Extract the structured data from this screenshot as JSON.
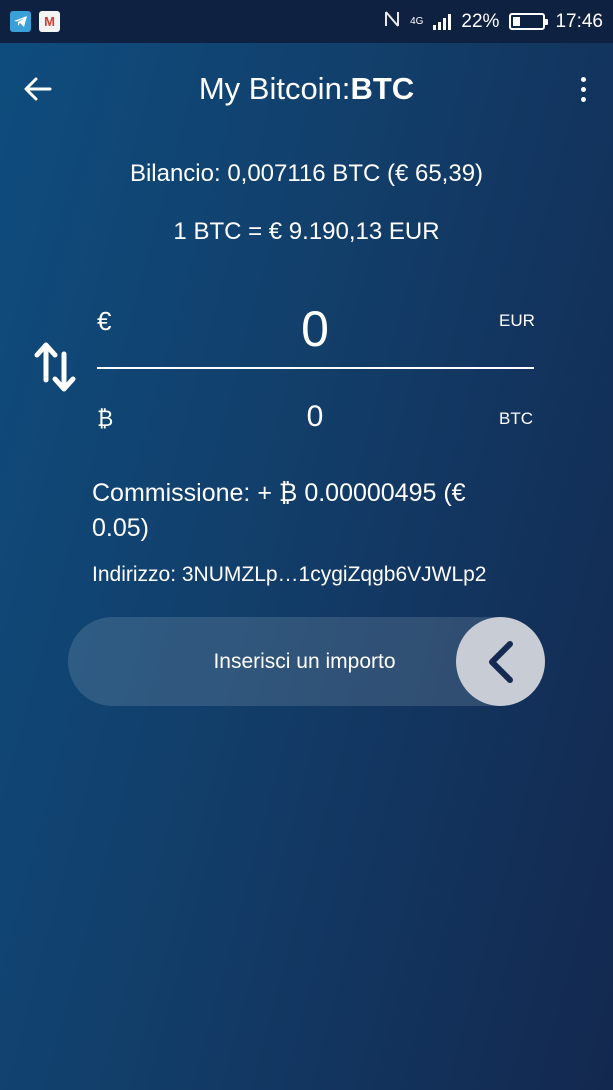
{
  "status_bar": {
    "battery_percent": "22%",
    "time": "17:46",
    "network_type": "4G",
    "battery_level": 0.22,
    "icons": [
      "telegram-icon",
      "gmail-icon",
      "nfc-icon",
      "signal-icon",
      "battery-icon"
    ]
  },
  "app_bar": {
    "title_prefix": "My Bitcoin:",
    "title_code": "BTC"
  },
  "balance_text": "Bilancio: 0,007116 BTC (€ 65,39)",
  "rate_text": "1 BTC = € 9.190,13 EUR",
  "converter": {
    "primary": {
      "symbol": "€",
      "amount": "0",
      "code": "EUR"
    },
    "secondary": {
      "symbol": "₿",
      "amount": "0",
      "code": "BTC"
    }
  },
  "fee_text": "Commissione: + ₿ 0.00000495 (€ 0.05)",
  "address_text": "Indirizzo: 3NUMZLp…1cygiZqgb6VJWLp2",
  "slider": {
    "label": "Inserisci un importo"
  },
  "colors": {
    "background_start": "#0e4d7e",
    "background_end": "#13284f",
    "status_bar": "#0f2140",
    "handle": "#c8ccd4",
    "handle_arrow": "#142a52"
  }
}
